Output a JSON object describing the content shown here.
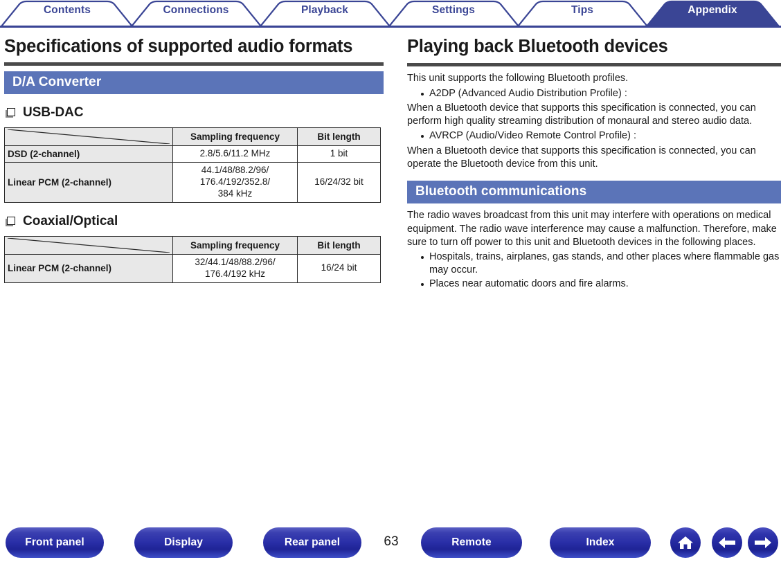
{
  "tabs": [
    {
      "label": "Contents",
      "active": false
    },
    {
      "label": "Connections",
      "active": false
    },
    {
      "label": "Playback",
      "active": false
    },
    {
      "label": "Settings",
      "active": false
    },
    {
      "label": "Tips",
      "active": false
    },
    {
      "label": "Appendix",
      "active": true
    }
  ],
  "colors": {
    "tab_blue": "#3a4595",
    "band_blue": "#5b74b8",
    "rule_gray": "#4a4a4a",
    "table_header_gray": "#e8e8e8",
    "button_blue": "#2a2fa8"
  },
  "left": {
    "heading": "Specifications of supported audio formats",
    "band": "D/A Converter",
    "sections": [
      {
        "subheading": "USB-DAC",
        "table": {
          "headers": [
            "",
            "Sampling frequency",
            "Bit length"
          ],
          "rows": [
            {
              "name": "DSD (2-channel)",
              "sampling": "2.8/5.6/11.2 MHz",
              "bit": "1 bit"
            },
            {
              "name": "Linear PCM (2-channel)",
              "sampling": "44.1/48/88.2/96/\n176.4/192/352.8/\n384 kHz",
              "bit": "16/24/32 bit"
            }
          ]
        }
      },
      {
        "subheading": "Coaxial/Optical",
        "table": {
          "headers": [
            "",
            "Sampling frequency",
            "Bit length"
          ],
          "rows": [
            {
              "name": "Linear PCM (2-channel)",
              "sampling": "32/44.1/48/88.2/96/\n176.4/192 kHz",
              "bit": "16/24 bit"
            }
          ]
        }
      }
    ]
  },
  "right": {
    "heading": "Playing back Bluetooth devices",
    "intro": "This unit supports the following Bluetooth profiles.",
    "profiles": [
      {
        "bullet": "A2DP (Advanced Audio Distribution Profile) :",
        "body": "When a Bluetooth device that supports this specification is connected, you can perform high quality streaming distribution of monaural and stereo audio data."
      },
      {
        "bullet": "AVRCP (Audio/Video Remote Control Profile) :",
        "body": "When a Bluetooth device that supports this specification is connected, you can operate the Bluetooth device from this unit."
      }
    ],
    "band": "Bluetooth communications",
    "warning": "The radio waves broadcast from this unit may interfere with operations on medical equipment. The radio wave interference may cause a malfunction. Therefore, make sure to turn off power to this unit and Bluetooth devices in the following places.",
    "warning_items": [
      "Hospitals, trains, airplanes, gas stands, and other places where flammable gas may occur.",
      "Places near automatic doors and fire alarms."
    ]
  },
  "footer": {
    "buttons": [
      {
        "label": "Front panel"
      },
      {
        "label": "Display"
      },
      {
        "label": "Rear panel"
      },
      {
        "label": "Remote"
      },
      {
        "label": "Index"
      }
    ],
    "page_number": "63",
    "icons": [
      "home-icon",
      "arrow-left-icon",
      "arrow-right-icon"
    ]
  }
}
